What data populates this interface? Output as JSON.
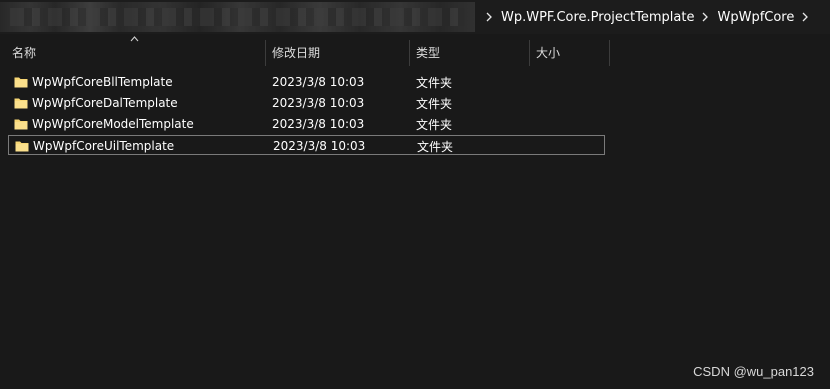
{
  "address_bar": {
    "crumbs": [
      "Wp.WPF.Core.ProjectTemplate",
      "WpWpfCore"
    ]
  },
  "columns": {
    "name": "名称",
    "date_modified": "修改日期",
    "type": "类型",
    "size": "大小"
  },
  "files": [
    {
      "name": "WpWpfCoreBllTemplate",
      "date": "2023/3/8 10:03",
      "type": "文件夹",
      "icon": "folder-icon"
    },
    {
      "name": "WpWpfCoreDalTemplate",
      "date": "2023/3/8 10:03",
      "type": "文件夹",
      "icon": "folder-icon"
    },
    {
      "name": "WpWpfCoreModelTemplate",
      "date": "2023/3/8 10:03",
      "type": "文件夹",
      "icon": "folder-icon"
    },
    {
      "name": "WpWpfCoreUilTemplate",
      "date": "2023/3/8 10:03",
      "type": "文件夹",
      "icon": "folder-icon"
    }
  ],
  "watermark": "CSDN @wu_pan123",
  "colors": {
    "background": "#191919",
    "folder": "#f8d775",
    "text": "#ffffff",
    "focus_border": "#7a7a7a"
  }
}
